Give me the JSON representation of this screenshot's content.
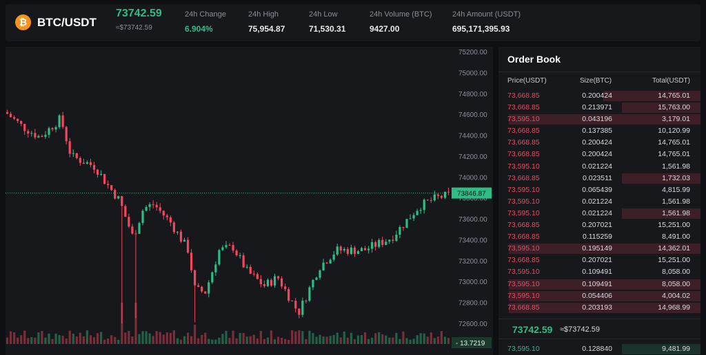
{
  "header": {
    "coin_symbol": "₿",
    "pair": "BTC/USDT",
    "last_price": "73742.59",
    "last_price_usd": "≈$73742.59",
    "stats": [
      {
        "label": "24h Change",
        "value": "6.904%",
        "positive": true
      },
      {
        "label": "24h High",
        "value": "75,954.87"
      },
      {
        "label": "24h Low",
        "value": "71,530.31"
      },
      {
        "label": "24h Volume (BTC)",
        "value": "9427.00"
      },
      {
        "label": "24h Amount (USDT)",
        "value": "695,171,395.93"
      }
    ]
  },
  "chart": {
    "price_axis_labels": [
      "75200.00",
      "75000.00",
      "74800.00",
      "74600.00",
      "74400.00",
      "74200.00",
      "74000.00",
      "73800.00",
      "73600.00",
      "73400.00",
      "73200.00",
      "73000.00",
      "72800.00",
      "72600.00"
    ],
    "current_price_tag": "73846.87",
    "volume_tag": "13.7219",
    "colors": {
      "up": "#2ebd85",
      "down": "#f6465d",
      "background": "#17181c"
    }
  },
  "orderbook": {
    "title": "Order Book",
    "headers": {
      "price": "Price(USDT)",
      "size": "Size(BTC)",
      "total": "Total(USDT)"
    },
    "asks": [
      {
        "price": "73,668.85",
        "size": "0.200424",
        "total": "14,765.01",
        "depth": 0.48
      },
      {
        "price": "73,668.85",
        "size": "0.213971",
        "total": "15,763.00",
        "depth": 0.39
      },
      {
        "price": "73,595.10",
        "size": "0.043196",
        "total": "3,179.01",
        "depth": 0.95
      },
      {
        "price": "73,668.85",
        "size": "0.137385",
        "total": "10,120.99",
        "depth": 0.0
      },
      {
        "price": "73,668.85",
        "size": "0.200424",
        "total": "14,765.01",
        "depth": 0.0
      },
      {
        "price": "73,668.85",
        "size": "0.200424",
        "total": "14,765.01",
        "depth": 0.0
      },
      {
        "price": "73,595.10",
        "size": "0.021224",
        "total": "1,561.98",
        "depth": 0.0
      },
      {
        "price": "73,668.85",
        "size": "0.023511",
        "total": "1,732.03",
        "depth": 0.39
      },
      {
        "price": "73,595.10",
        "size": "0.065439",
        "total": "4,815.99",
        "depth": 0.0
      },
      {
        "price": "73,595.10",
        "size": "0.021224",
        "total": "1,561.98",
        "depth": 0.0
      },
      {
        "price": "73,595.10",
        "size": "0.021224",
        "total": "1,561.98",
        "depth": 0.39
      },
      {
        "price": "73,668.85",
        "size": "0.207021",
        "total": "15,251.00",
        "depth": 0.0
      },
      {
        "price": "73,668.85",
        "size": "0.115259",
        "total": "8,491.00",
        "depth": 0.0
      },
      {
        "price": "73,595.10",
        "size": "0.195149",
        "total": "14,362.01",
        "depth": 0.95
      },
      {
        "price": "73,668.85",
        "size": "0.207021",
        "total": "15,251.00",
        "depth": 0.0
      },
      {
        "price": "73,595.10",
        "size": "0.109491",
        "total": "8,058.00",
        "depth": 0.0
      },
      {
        "price": "73,595.10",
        "size": "0.109491",
        "total": "8,058.00",
        "depth": 0.95
      },
      {
        "price": "73,595.10",
        "size": "0.054406",
        "total": "4,004.02",
        "depth": 0.95
      },
      {
        "price": "73,668.85",
        "size": "0.203193",
        "total": "14,968.99",
        "depth": 0.95
      }
    ],
    "mid_price": "73742.59",
    "mid_price_usd": "≈$73742.59",
    "bids": [
      {
        "price": "73,595.10",
        "size": "0.128840",
        "total": "9,481.99",
        "depth": 0.39
      }
    ]
  }
}
